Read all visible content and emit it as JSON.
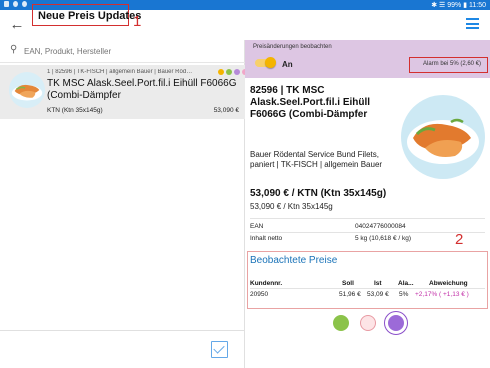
{
  "statusbar": {
    "right_text": "✱ ☰ 99% ▮ 11:50"
  },
  "appbar": {
    "back_icon": "arrow-left-icon",
    "title": "Neue Preis Updates",
    "annotation": "1",
    "menu_icon": "hamburger-menu-icon"
  },
  "search": {
    "placeholder": "EAN, Produkt, Hersteller"
  },
  "list": {
    "items": [
      {
        "meta": "1 | 82596 | TK-FISCH | allgemein Bauer | Bauer Röd…",
        "name": "TK MSC Alask.Seel.Port.fil.i Eihüll F6066G (Combi-Dämpfer",
        "unit": "KTN (Ktn 35x145g)",
        "price": "53,090 €",
        "dots": [
          "#f4b400",
          "#8bc34a",
          "#b58ad8",
          "#f1a7c8"
        ]
      }
    ]
  },
  "detail": {
    "watch_label": "Preisänderungen beobachten",
    "toggle_text": "An",
    "alarm_text": "Alarm bei 5% (2,60 €)",
    "title": "82596 | TK MSC Alask.Seel.Port.fil.i Eihüll F6066G (Combi-Dämpfer",
    "supplier": "Bauer Rödental Service Bund Filets, paniert | TK-FISCH | allgemein Bauer",
    "price_main": "53,090 € / KTN (Ktn 35x145g)",
    "price_sub": "53,090 € / Ktn 35x145g",
    "ean_label": "EAN",
    "ean_value": "04024776000084",
    "content_label": "Inhalt netto",
    "content_value": "5 kg (10,618 € / kg)",
    "annotation": "2",
    "section_title": "Beobachtete Preise",
    "table": {
      "headers": [
        "Kundennr.",
        "Soll",
        "Ist",
        "Ala...",
        "Abweichung"
      ],
      "row": [
        "20950",
        "51,96 €",
        "53,09 €",
        "5%",
        "+2,17% ( +1,13 € )"
      ]
    }
  },
  "colors": {
    "accent": "#1e88e5",
    "watch_bg": "#ddc6e3",
    "annotation": "#d32f2f"
  }
}
